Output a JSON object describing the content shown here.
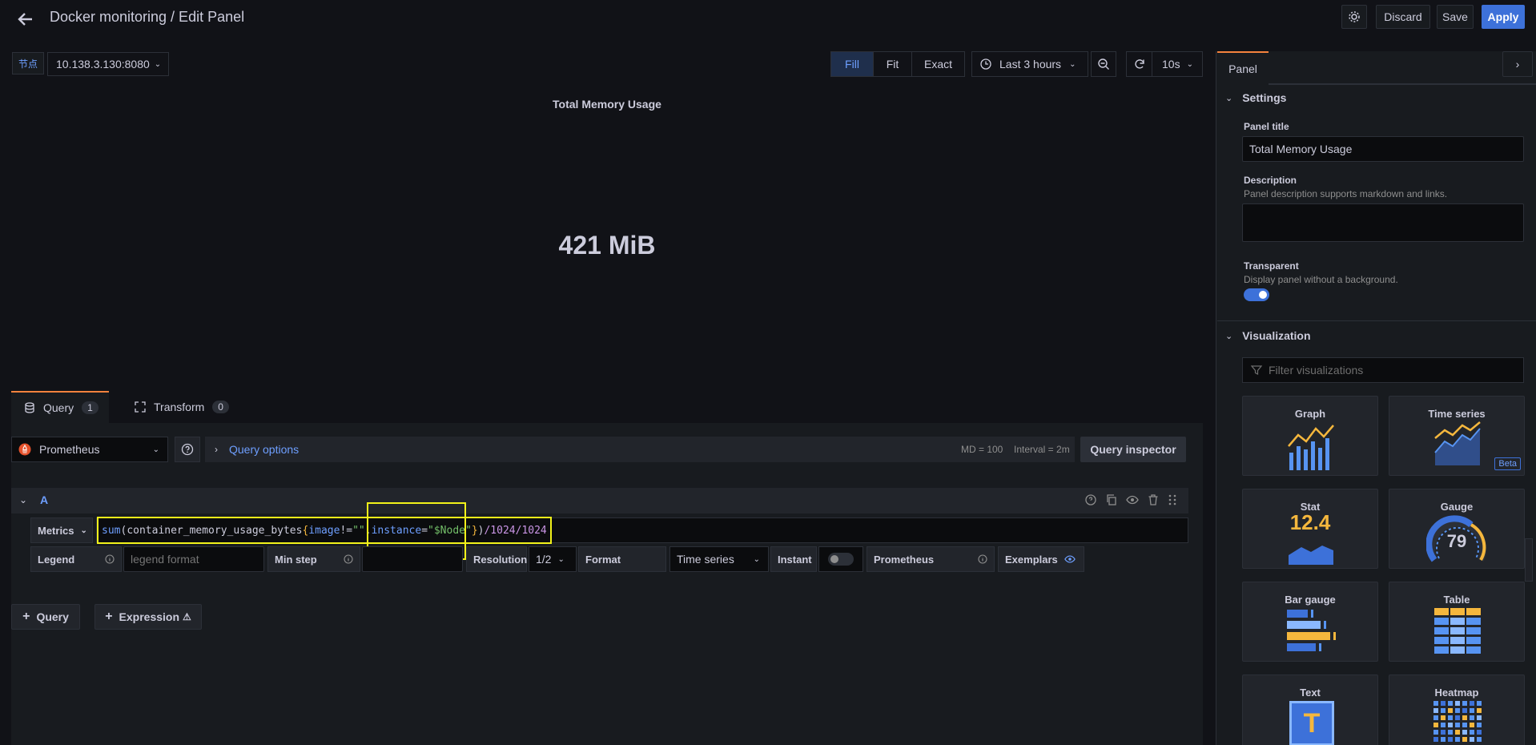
{
  "header": {
    "title": "Docker monitoring / Edit Panel",
    "discard": "Discard",
    "save": "Save",
    "apply": "Apply"
  },
  "variables": {
    "node_label": "节点",
    "node_value": "10.138.3.130:8080"
  },
  "toolbar": {
    "fill": "Fill",
    "fit": "Fit",
    "exact": "Exact",
    "time_range": "Last 3 hours",
    "refresh_interval": "10s"
  },
  "panel": {
    "title": "Total Memory Usage",
    "value": "421 MiB"
  },
  "editor_tabs": {
    "query_label": "Query",
    "query_count": "1",
    "transform_label": "Transform",
    "transform_count": "0"
  },
  "datasource": {
    "name": "Prometheus",
    "query_options": "Query options",
    "md": "MD = 100",
    "interval": "Interval = 2m",
    "inspector": "Query inspector"
  },
  "query": {
    "ref": "A",
    "metrics_label": "Metrics",
    "expr_parts": [
      "sum",
      "(",
      "container_memory_usage_bytes",
      "{",
      "image",
      "!=",
      "\"\"",
      ",",
      "instance",
      "=",
      "\"$Node\"",
      "}",
      ")",
      "/1024/1024"
    ],
    "legend_label": "Legend",
    "legend_placeholder": "legend format",
    "min_step_label": "Min step",
    "resolution_label": "Resolution",
    "resolution_value": "1/2",
    "format_label": "Format",
    "format_value": "Time series",
    "instant_label": "Instant",
    "prometheus_label": "Prometheus",
    "exemplars_label": "Exemplars"
  },
  "add": {
    "query": "Query",
    "expression": "Expression"
  },
  "sidebar": {
    "tab": "Panel",
    "settings_title": "Settings",
    "panel_title_label": "Panel title",
    "panel_title_value": "Total Memory Usage",
    "description_label": "Description",
    "description_hint": "Panel description supports markdown and links.",
    "transparent_label": "Transparent",
    "transparent_hint": "Display panel without a background.",
    "visualization_title": "Visualization",
    "filter_placeholder": "Filter visualizations",
    "viz": {
      "graph": "Graph",
      "timeseries": "Time series",
      "beta": "Beta",
      "stat": "Stat",
      "stat_value": "12.4",
      "gauge": "Gauge",
      "gauge_value": "79",
      "bargauge": "Bar gauge",
      "table": "Table",
      "text": "Text",
      "text_glyph": "T",
      "heatmap": "Heatmap"
    }
  },
  "colors": {
    "accent": "#3d71d9",
    "orange": "#f5b73d",
    "blue": "#5794f2",
    "highlight_box": "#f2f21a"
  }
}
